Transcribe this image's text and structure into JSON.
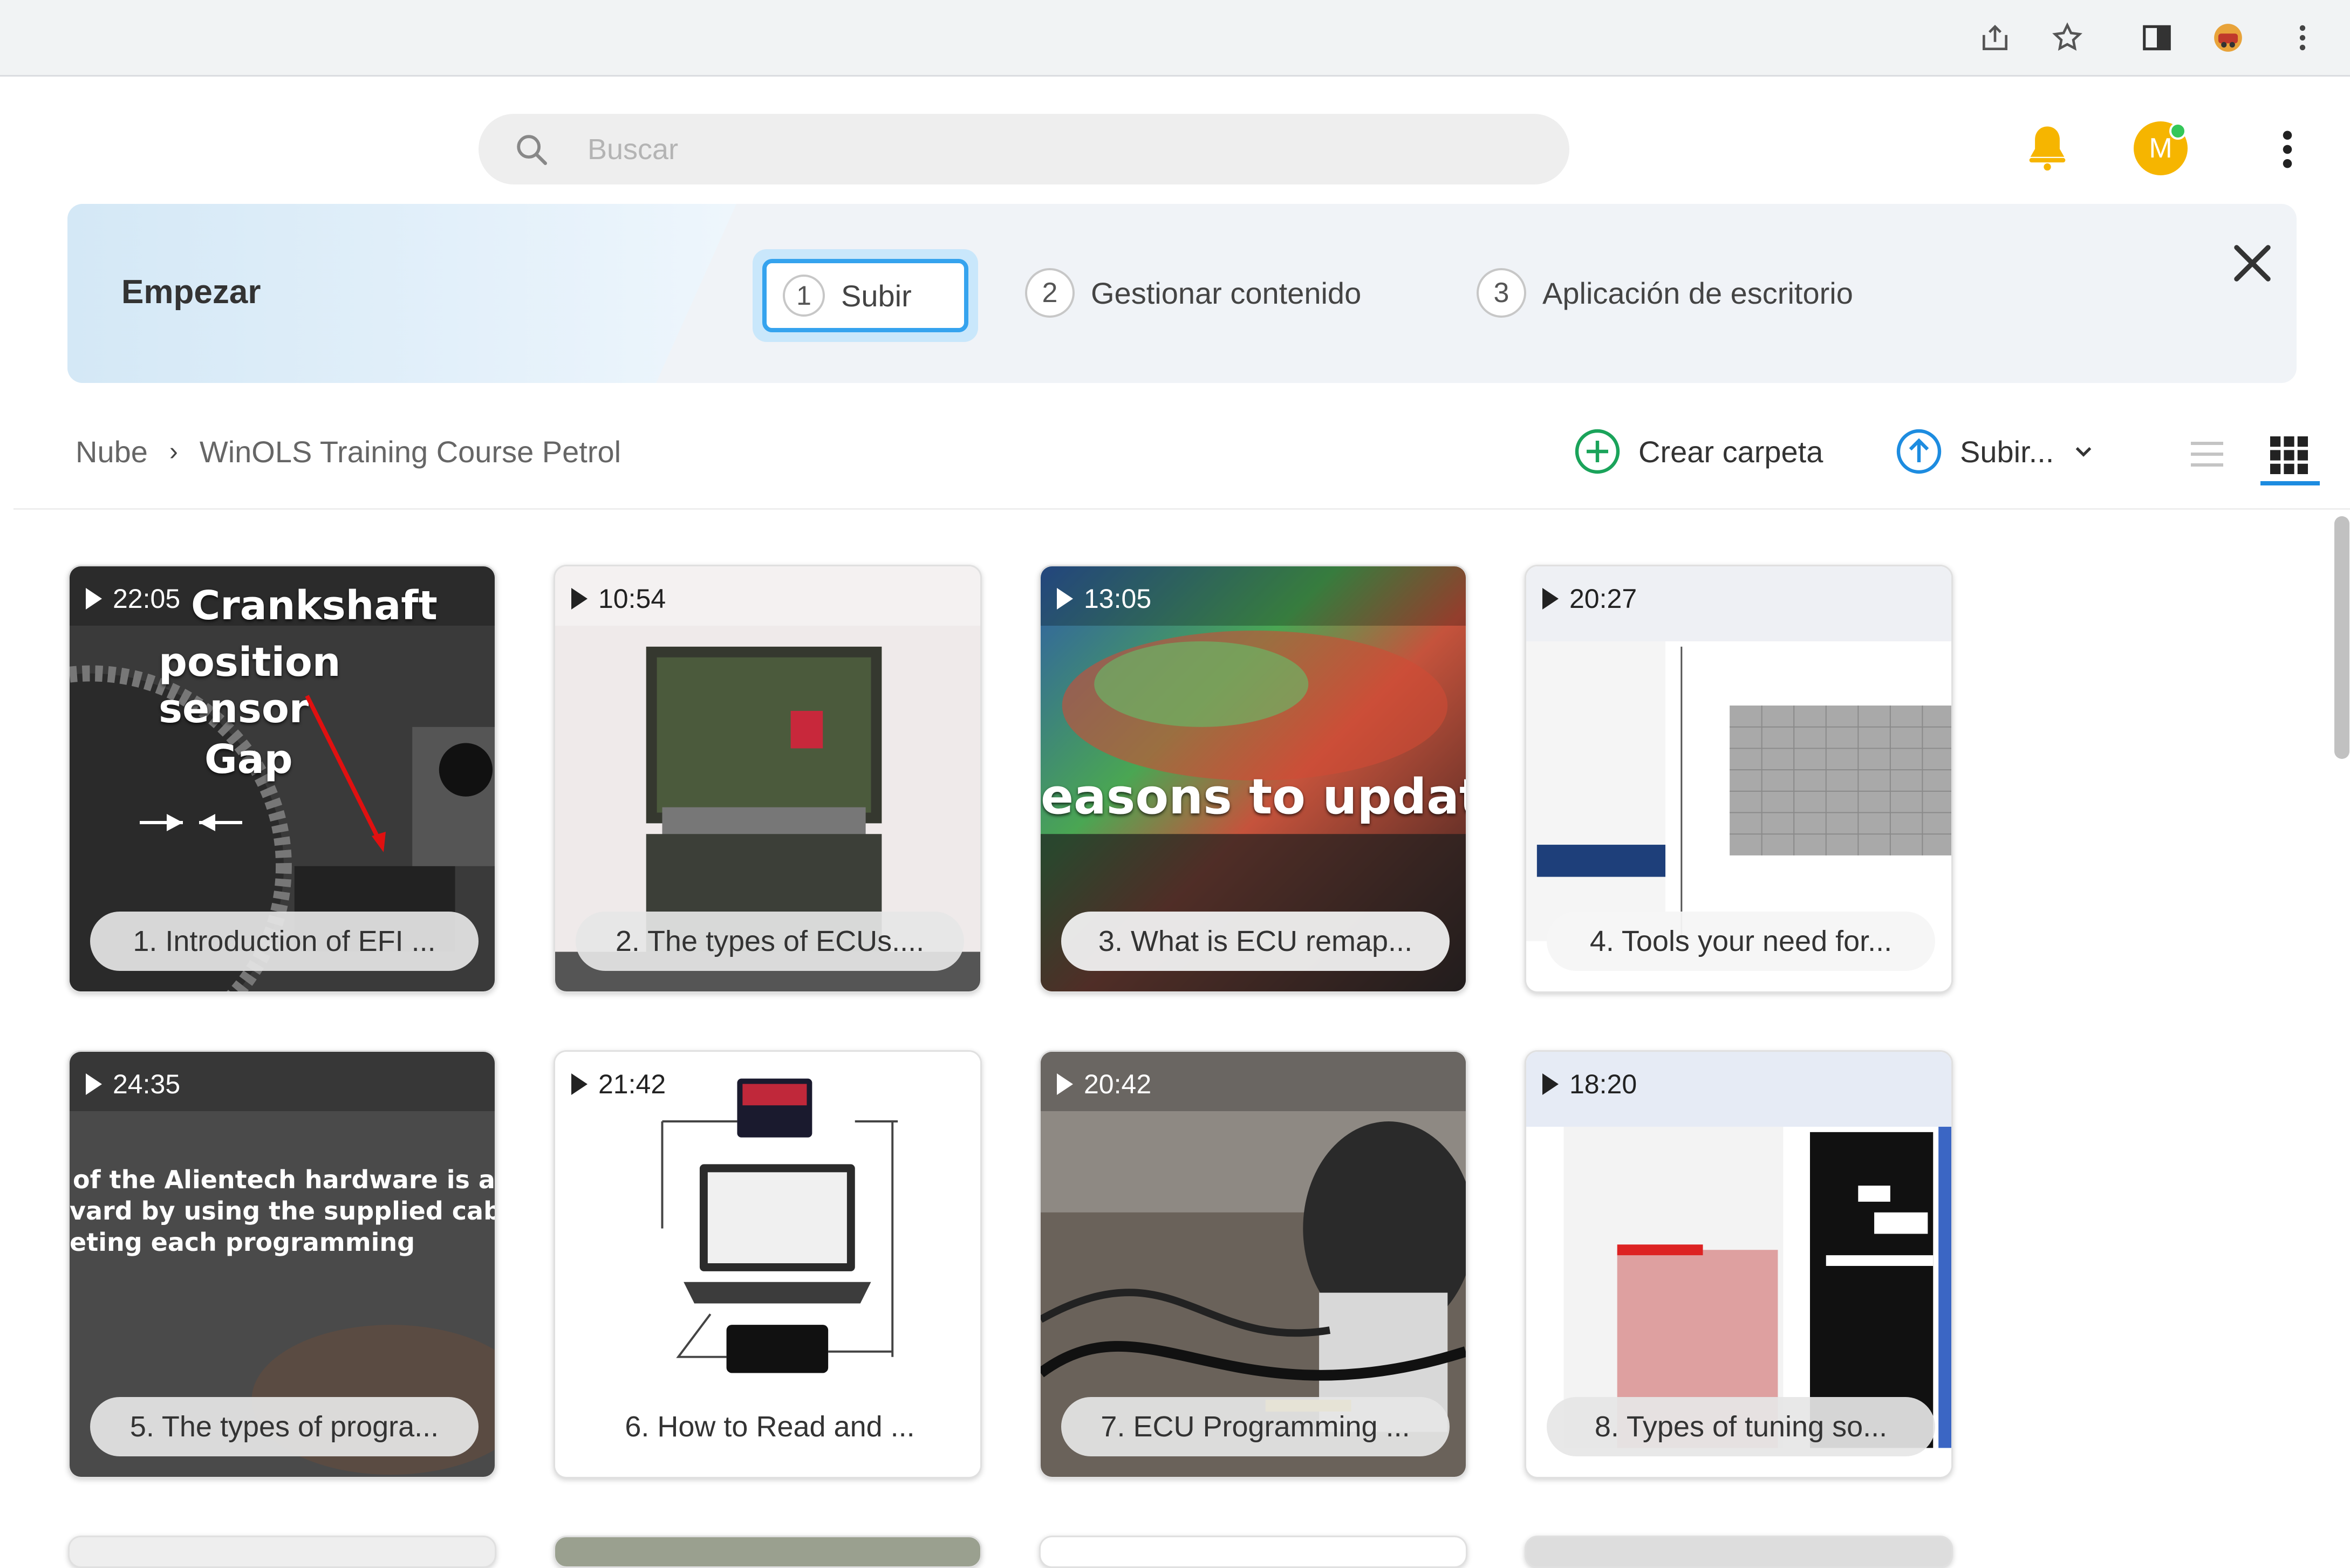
{
  "browser": {
    "icons": [
      "share-icon",
      "star-icon",
      "sidebar-icon",
      "extension-avatar-icon",
      "browser-menu-icon"
    ]
  },
  "header": {
    "search_placeholder": "Buscar",
    "avatar_initial": "M"
  },
  "banner": {
    "title": "Empezar",
    "steps": [
      {
        "num": "1",
        "label": "Subir"
      },
      {
        "num": "2",
        "label": "Gestionar contenido"
      },
      {
        "num": "3",
        "label": "Aplicación de escritorio"
      }
    ]
  },
  "breadcrumb": {
    "root": "Nube",
    "current": "WinOLS Training Course Petrol"
  },
  "actions": {
    "create_folder": "Crear carpeta",
    "upload": "Subir..."
  },
  "videos": [
    {
      "duration": "22:05",
      "title": "1. Introduction of EFI ...",
      "overlay": [
        "Crankshaft",
        "position sensor",
        "Gap"
      ]
    },
    {
      "duration": "10:54",
      "title": "2. The types of ECUs...."
    },
    {
      "duration": "13:05",
      "title": "3. What is ECU remap...",
      "overlay": [
        "easons to update"
      ]
    },
    {
      "duration": "20:27",
      "title": "4. Tools your need for..."
    },
    {
      "duration": "24:35",
      "title": "5. The types of progra...",
      "overlay": [
        "of the Alientech hardware is a",
        "vard by using the supplied cable",
        "eting each programming"
      ]
    },
    {
      "duration": "21:42",
      "title": "6. How to Read and ..."
    },
    {
      "duration": "20:42",
      "title": "7. ECU Programming ..."
    },
    {
      "duration": "18:20",
      "title": "8. Types of tuning so..."
    }
  ],
  "colors": {
    "accent_blue": "#35a3ee",
    "green_action": "#1aa35a",
    "avatar": "#f6b500",
    "bell": "#f6b500"
  }
}
